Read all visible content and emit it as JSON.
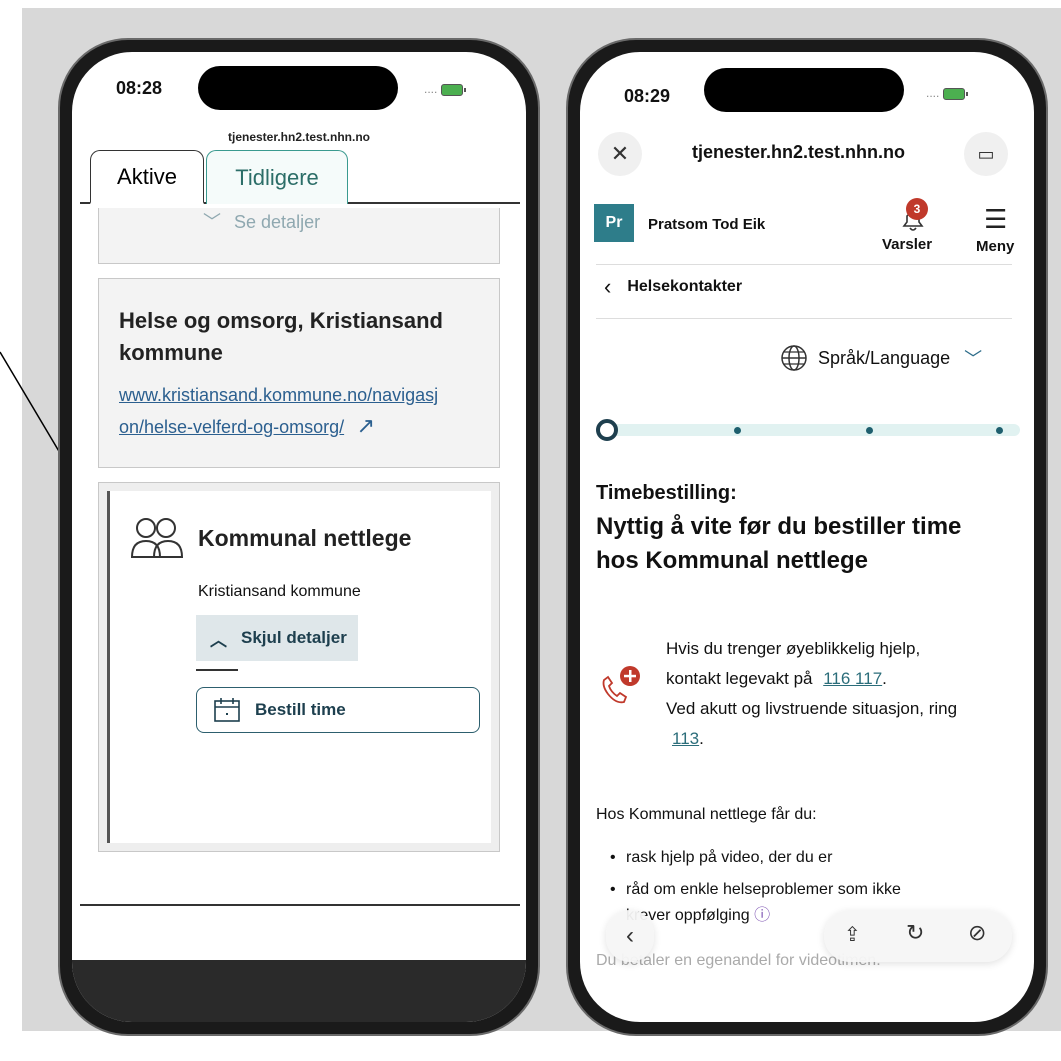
{
  "left_phone": {
    "status_time": "08:28",
    "status_dots": "....",
    "url": "tjenester.hn2.test.nhn.no",
    "tabs": [
      {
        "label": "Aktive"
      },
      {
        "label": "Tidligere"
      }
    ],
    "collapsed_details_label": "Se detaljer",
    "card_helse": {
      "title": "Helse og omsorg, Kristiansand kommune",
      "link_line1": "www.kristiansand.kommune.no/navigasj",
      "link_line2": "on/helse-velferd-og-omsorg/"
    },
    "card_nettlege": {
      "title": "Kommunal nettlege",
      "subtitle": "Kristiansand kommune",
      "toggle_label": "Skjul detaljer",
      "book_label": "Bestill time"
    }
  },
  "right_phone": {
    "status_time": "08:29",
    "status_dots": "....",
    "url": "tjenester.hn2.test.nhn.no",
    "user_initials": "Pr",
    "user_name": "Pratsom Tod Eik",
    "notifications_count": "3",
    "notifications_label": "Varsler",
    "menu_label": "Meny",
    "back_label": "Helsekontakter",
    "language_label": "Språk/Language",
    "progress": {
      "current_step": 1,
      "total_steps": 4
    },
    "heading_small": "Timebestilling:",
    "heading_large_line1": "Nyttig å vite før du bestiller time",
    "heading_large_line2": "hos Kommunal nettlege",
    "info": {
      "line1": "Hvis du trenger øyeblikkelig hjelp,",
      "line2_prefix": "kontakt legevakt på",
      "legevakt_number": "116 117",
      "line2_suffix": ".",
      "line3": "Ved akutt og livstruende situasjon, ring",
      "emergency_number": "113",
      "line4_suffix": "."
    },
    "benefits_heading": "Hos Kommunal nettlege får du:",
    "benefits": [
      "rask hjelp på video, der du er",
      "råd om enkle helseproblemer som ikke"
    ],
    "benefit_cont": "krever oppfølging",
    "footer_text": "Du betaler en egenandel for videotimen."
  },
  "colors": {
    "teal": "#2e7d8a",
    "dark_blue": "#1d3f4e",
    "danger_red": "#c0392b",
    "link": "#2b5f8f"
  }
}
